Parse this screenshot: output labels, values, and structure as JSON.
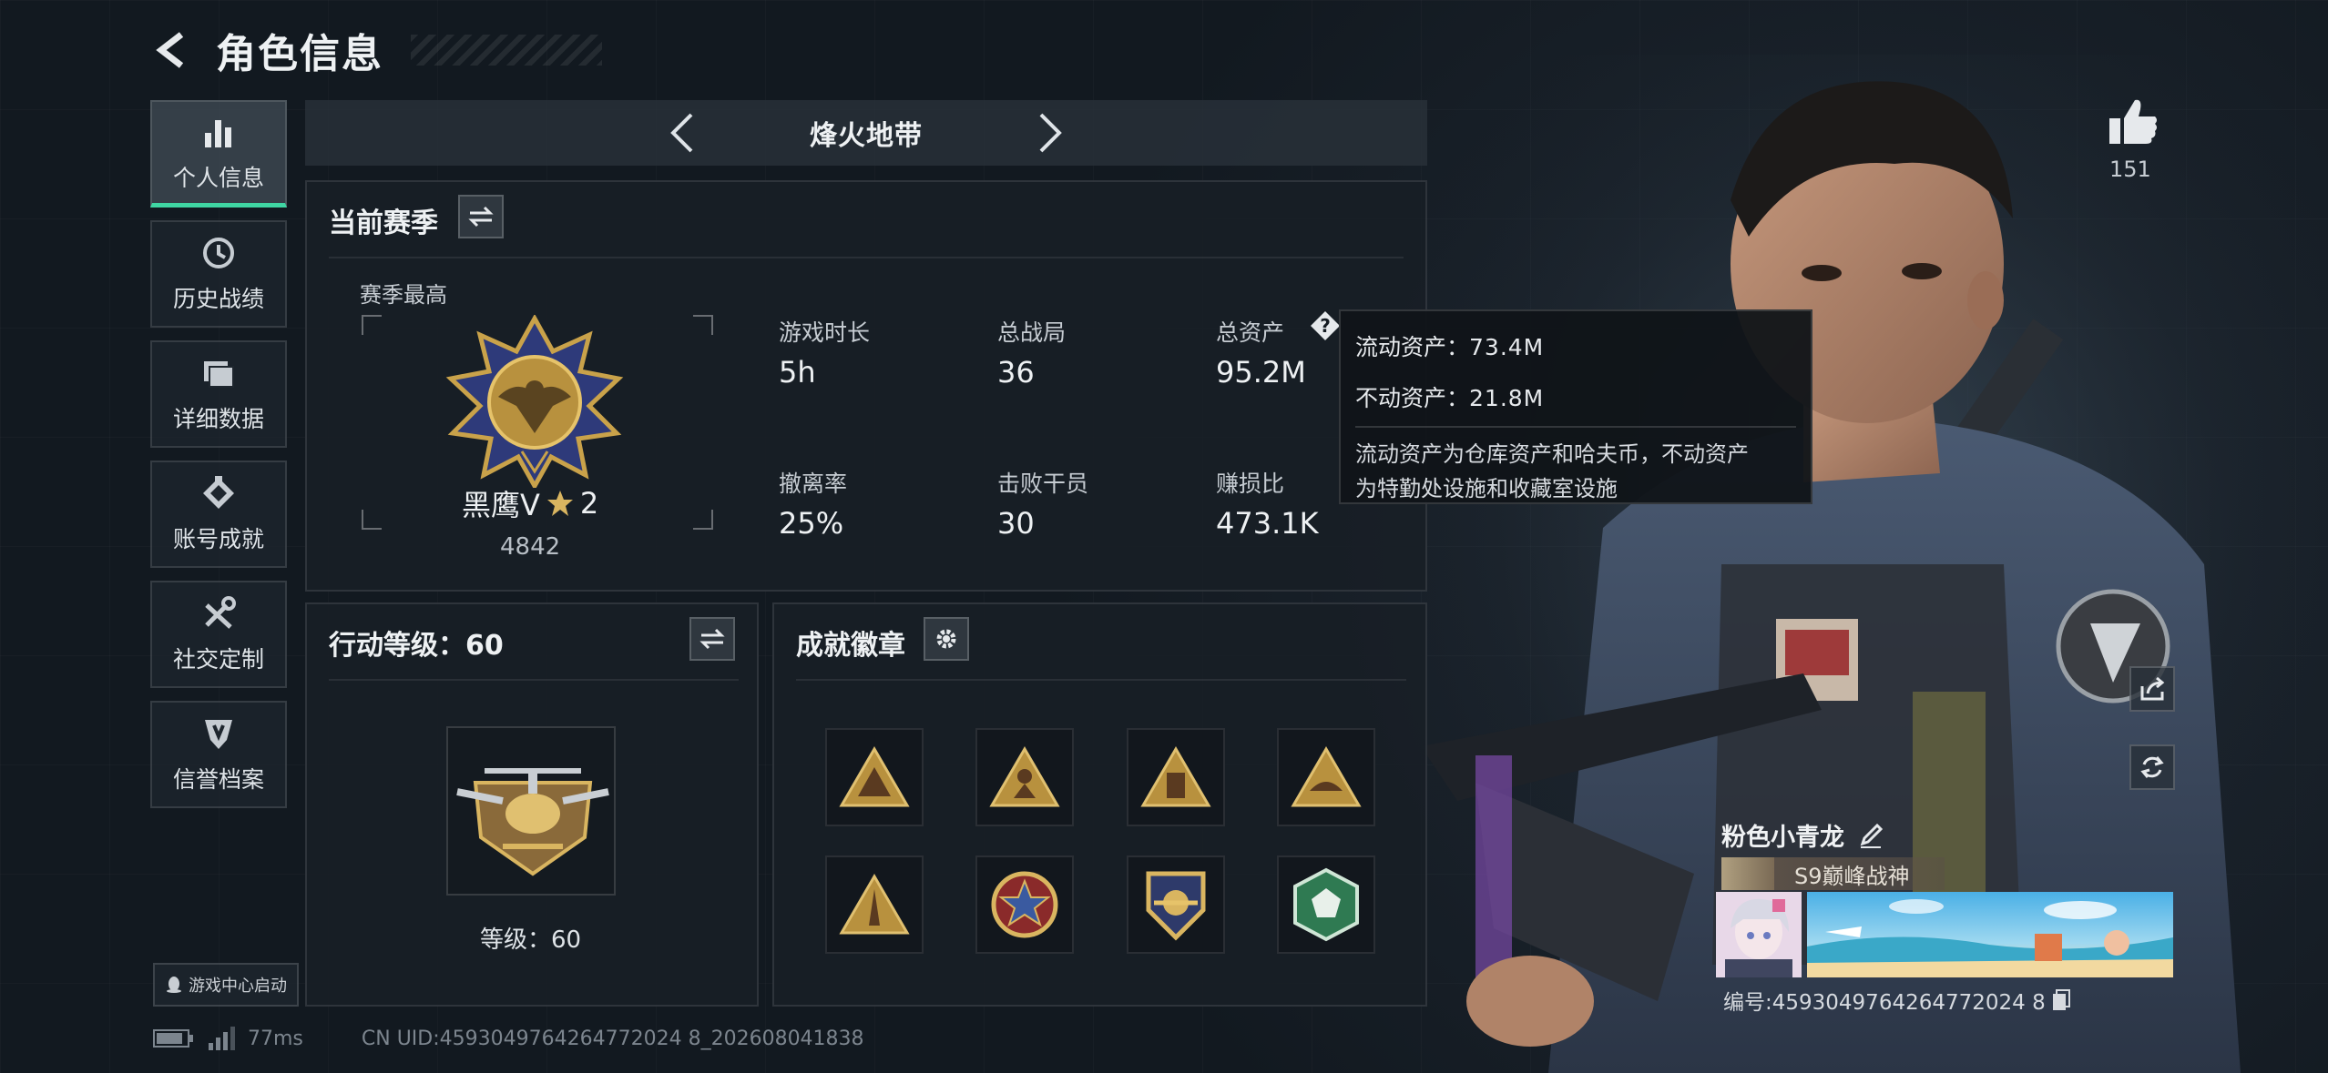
{
  "header": {
    "title": "角色信息"
  },
  "sidebar": {
    "items": [
      {
        "label": "个人信息",
        "icon": "bar-chart-icon"
      },
      {
        "label": "历史战绩",
        "icon": "history-icon"
      },
      {
        "label": "详细数据",
        "icon": "folder-icon"
      },
      {
        "label": "账号成就",
        "icon": "achievement-icon"
      },
      {
        "label": "社交定制",
        "icon": "tools-icon"
      },
      {
        "label": "信誉档案",
        "icon": "shield-icon"
      }
    ],
    "launch_label": "游戏中心启动"
  },
  "status": {
    "ping": "77ms",
    "uid": "CN UID:4593049764264772024 8_202608041838"
  },
  "mode": {
    "title": "烽火地带"
  },
  "season": {
    "title": "当前赛季",
    "sub_label": "赛季最高",
    "rank_name": "黑鹰V",
    "rank_stars": "2",
    "rank_score": "4842",
    "stats": [
      {
        "label": "游戏时长",
        "value": "5h"
      },
      {
        "label": "总战局",
        "value": "36"
      },
      {
        "label": "总资产",
        "value": "95.2M"
      },
      {
        "label": "撤离率",
        "value": "25%"
      },
      {
        "label": "击败干员",
        "value": "30"
      },
      {
        "label": "赚损比",
        "value": "473.1K"
      }
    ]
  },
  "tooltip": {
    "liquid_label": "流动资产：",
    "liquid_value": "73.4M",
    "fixed_label": "不动资产：",
    "fixed_value": "21.8M",
    "desc_line1": "流动资产为仓库资产和哈夫币，不动资产",
    "desc_line2": "为特勤处设施和收藏室设施"
  },
  "level": {
    "title": "行动等级：60",
    "label": "等级：60"
  },
  "badges": {
    "title": "成就徽章",
    "items": [
      "triangle-badge-1",
      "triangle-badge-2",
      "triangle-badge-3",
      "triangle-badge-4",
      "triangle-badge-5",
      "star-badge",
      "shield-badge",
      "green-badge"
    ]
  },
  "profile": {
    "likes": "151",
    "name": "粉色小青龙",
    "title": "S9巅峰战神",
    "id": "编号:4593049764264772024 8"
  },
  "colors": {
    "accent": "#3fd6a3",
    "gold": "#c9a24a"
  }
}
